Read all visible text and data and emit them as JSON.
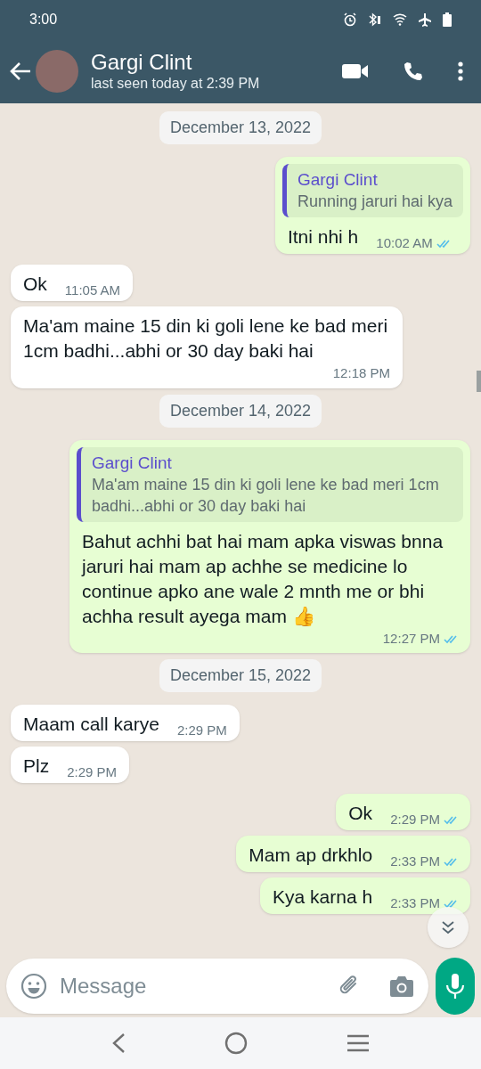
{
  "status_bar": {
    "time": "3:00"
  },
  "header": {
    "name": "Gargi Clint",
    "subtitle": "last seen today at 2:39 PM"
  },
  "messages": [
    {
      "kind": "date",
      "text": "December 13, 2022"
    },
    {
      "kind": "out",
      "quote": {
        "author": "Gargi Clint",
        "text": "Running jaruri hai kya"
      },
      "text": "Itni nhi h",
      "time": "10:02 AM",
      "read": true
    },
    {
      "kind": "in",
      "text": "Ok",
      "time": "11:05 AM"
    },
    {
      "kind": "in",
      "text": "Ma'am maine 15 din ki goli lene ke bad meri 1cm badhi...abhi or 30 day baki hai",
      "time": "12:18 PM"
    },
    {
      "kind": "date",
      "text": "December 14, 2022"
    },
    {
      "kind": "out",
      "quote": {
        "author": "Gargi Clint",
        "text": "Ma'am maine 15 din ki goli lene ke bad meri 1cm badhi...abhi or 30 day baki hai"
      },
      "text": "Bahut achhi bat hai mam apka viswas bnna jaruri hai mam ap achhe se medicine lo continue apko ane wale 2 mnth me or bhi achha result ayega mam 👍",
      "time": "12:27 PM",
      "read": true
    },
    {
      "kind": "date",
      "text": "December 15, 2022"
    },
    {
      "kind": "in",
      "text": "Maam call karye",
      "time": "2:29 PM"
    },
    {
      "kind": "in",
      "text": "Plz",
      "time": "2:29 PM"
    },
    {
      "kind": "out",
      "text": "Ok",
      "time": "2:29 PM",
      "read": true
    },
    {
      "kind": "out",
      "text": "Mam ap drkhlo",
      "time": "2:33 PM",
      "read": true
    },
    {
      "kind": "out",
      "text": "Kya karna h",
      "time": "2:33 PM",
      "read": true
    }
  ],
  "composer": {
    "placeholder": "Message"
  }
}
